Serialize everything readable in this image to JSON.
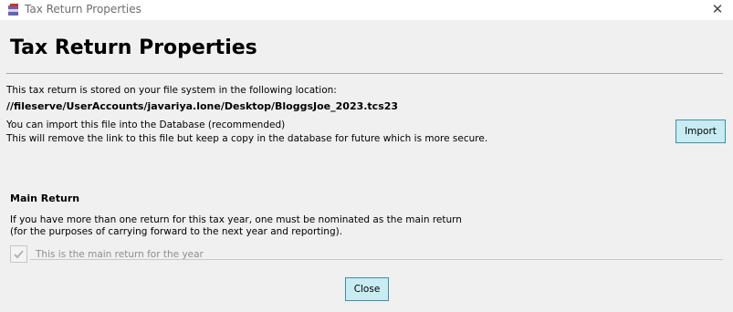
{
  "window": {
    "title": "Tax Return Properties",
    "icon": "tax-return-app-icon",
    "close_icon": "close-x-icon"
  },
  "header": {
    "title": "Tax Return Properties"
  },
  "location": {
    "intro": "This tax return is stored on your file system in the following location:",
    "path": "//fileserve/UserAccounts/javariya.lone/Desktop/BloggsJoe_2023.tcs23",
    "import_line1": "You can import this file into the Database (recommended)",
    "import_line2": "This will remove the link to this file but keep a copy in the database for future which is more secure.",
    "import_button": "Import"
  },
  "main_return": {
    "heading": "Main Return",
    "description_line1": "If you have more than one return for this tax year, one must be nominated as the main return",
    "description_line2": "(for the purposes of carrying forward to the next year and reporting).",
    "checkbox_label": "This is the main return for the year",
    "checkbox_checked": true,
    "checkbox_enabled": false
  },
  "footer": {
    "close_button": "Close"
  },
  "colors": {
    "button_fill": "#c8ecf2",
    "button_border": "#3d8fa8",
    "background": "#f0f0f0"
  }
}
